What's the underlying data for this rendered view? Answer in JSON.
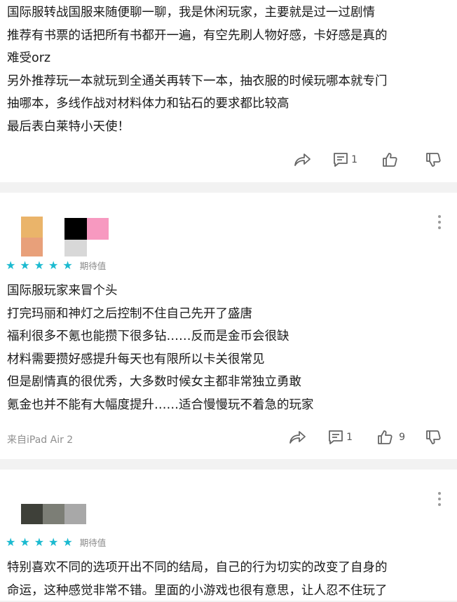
{
  "review1": {
    "lines": [
      "国际服转战国服来随便聊一聊，我是休闲玩家，主要就是过一过剧情",
      "推荐有书票的话把所有书都开一遍，有空先刷人物好感，卡好感是真的",
      "难受orz",
      "另外推荐玩一本就玩到全通关再转下一本，抽衣服的时候玩哪本就专门",
      "抽哪本，多线作战对材料体力和钻石的要求都比较高",
      "最后表白莱特小天使！"
    ],
    "reply_count": "1"
  },
  "review2": {
    "rating_label": "期待值",
    "stars": 5,
    "lines": [
      "国际服玩家来冒个头",
      "打完玛丽和神灯之后控制不住自己先开了盛唐",
      "福利很多不氪也能攒下很多钻……反而是金币会很缺",
      "材料需要攒好感提升每天也有限所以卡关很常见",
      "但是剧情真的很优秀，大多数时候女主都非常独立勇敢",
      "氪金也并不能有大幅度提升……适合慢慢玩不着急的玩家"
    ],
    "device": "来自iPad Air 2",
    "reply_count": "1",
    "like_count": "9"
  },
  "review3": {
    "rating_label": "期待值",
    "stars": 5,
    "lines": [
      "特别喜欢不同的选项开出不同的结局，自己的行为切实的改变了自身的",
      "命运，这种感觉非常不错。里面的小游戏也很有意思，让人忍不住玩了"
    ]
  },
  "colors": {
    "star": "#1bbad0",
    "avatar2": [
      "#eab46a",
      "#e8a07a",
      "#000000",
      "#f799c0",
      "#d8d8d8"
    ],
    "avatar3": [
      "#3e4039",
      "#7c7e76",
      "#a8a8a8"
    ]
  }
}
